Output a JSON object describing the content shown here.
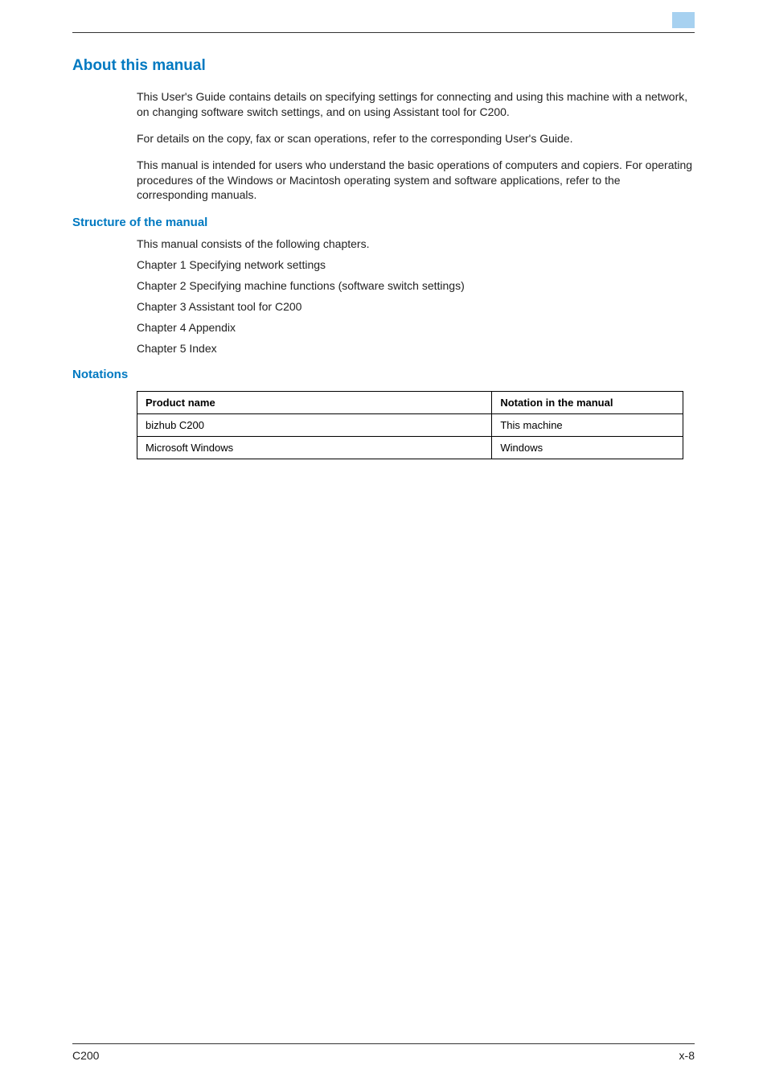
{
  "accent_color": "#0079c1",
  "headings": {
    "about": "About this manual",
    "structure": "Structure of the manual",
    "notations": "Notations"
  },
  "paragraphs": {
    "p1": "This User's Guide contains details on specifying settings for connecting and using this machine with a network, on changing software switch settings, and on using Assistant tool for C200.",
    "p2": "For details on the copy, fax or scan operations, refer to the corresponding User's Guide.",
    "p3": "This manual is intended for users who understand the basic operations of computers and copiers. For operating procedures of the Windows or Macintosh operating system and software applications, refer to the corresponding manuals."
  },
  "structure_lines": {
    "intro": "This manual consists of the following chapters.",
    "ch1": "Chapter 1 Specifying network settings",
    "ch2": "Chapter 2 Specifying machine functions (software switch settings)",
    "ch3": "Chapter 3 Assistant tool for C200",
    "ch4": "Chapter 4 Appendix",
    "ch5": "Chapter 5 Index"
  },
  "table": {
    "headers": {
      "col1": "Product name",
      "col2": "Notation in the manual"
    },
    "rows": [
      {
        "product": "bizhub C200",
        "notation": "This machine"
      },
      {
        "product": "Microsoft Windows",
        "notation": "Windows"
      }
    ]
  },
  "footer": {
    "left": "C200",
    "right": "x-8"
  }
}
